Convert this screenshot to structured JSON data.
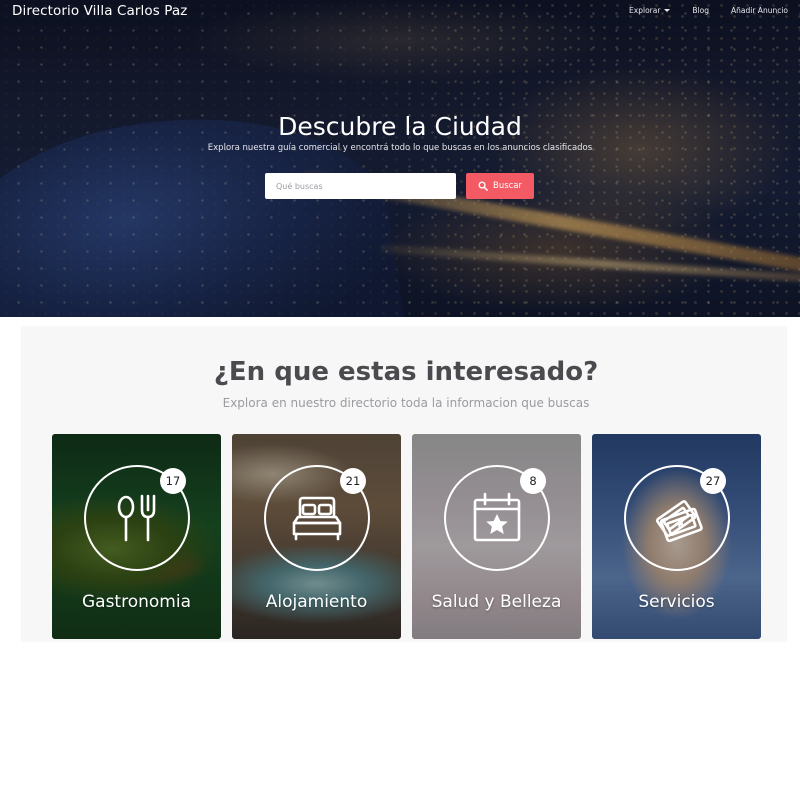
{
  "navbar": {
    "brand": "Directorio Villa Carlos Paz",
    "links": [
      {
        "label": "Explorar",
        "has_dropdown": true
      },
      {
        "label": "Blog",
        "has_dropdown": false
      },
      {
        "label": "Añadir Anuncio",
        "has_dropdown": false
      }
    ]
  },
  "hero": {
    "title": "Descubre la Ciudad",
    "subtitle": "Explora nuestra guía comercial y encontrá todo lo que buscas en los anuncios clasificados",
    "search": {
      "placeholder": "Qué buscas",
      "value": "",
      "button_label": "Buscar",
      "button_icon": "search-icon",
      "button_color": "#f35a63"
    }
  },
  "section": {
    "title": "¿En que estas interesado?",
    "subtitle": "Explora en nuestro directorio toda la informacion que buscas"
  },
  "categories": [
    {
      "label": "Gastronomia",
      "count": "17",
      "icon": "cutlery-icon"
    },
    {
      "label": "Alojamiento",
      "count": "21",
      "icon": "bed-icon"
    },
    {
      "label": "Salud y Belleza",
      "count": "8",
      "icon": "calendar-star-icon"
    },
    {
      "label": "Servicios",
      "count": "27",
      "icon": "tickets-icon"
    }
  ]
}
